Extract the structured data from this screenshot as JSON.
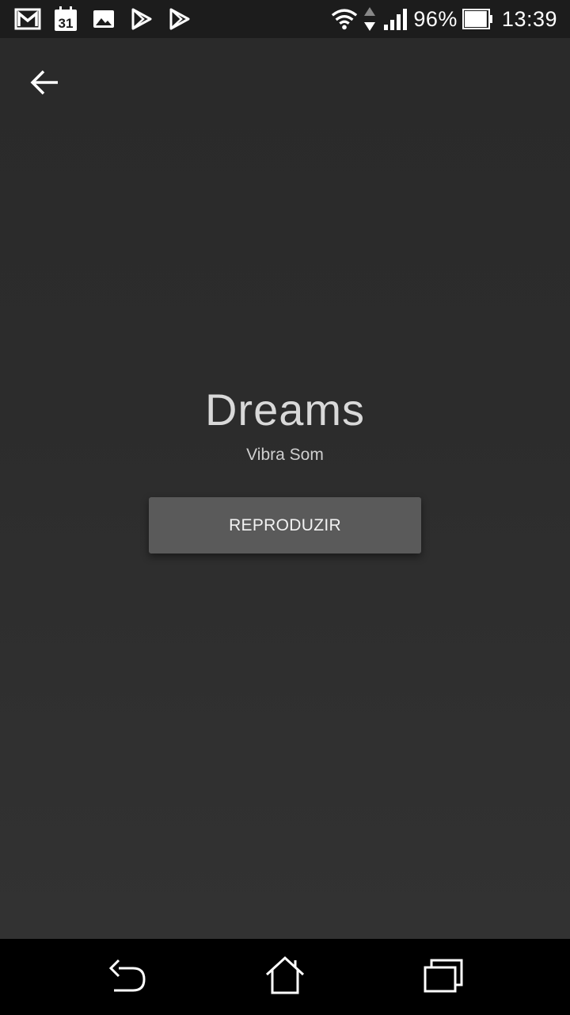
{
  "status_bar": {
    "left_icons": [
      "gmail-icon",
      "calendar-icon",
      "gallery-icon",
      "play-store-icon",
      "play-store-icon"
    ],
    "calendar_day": "31",
    "right_icons": [
      "wifi-icon",
      "data-transfer-icon",
      "signal-icon",
      "battery-icon"
    ],
    "battery_percent": "96%",
    "battery_level": 0.96,
    "time": "13:39"
  },
  "toolbar": {
    "back_icon": "arrow-back-icon"
  },
  "track": {
    "title": "Dreams",
    "artist": "Vibra Som",
    "play_label": "REPRODUZIR"
  },
  "nav_bar": {
    "icons": [
      "back-nav-icon",
      "home-nav-icon",
      "recent-apps-icon"
    ]
  },
  "colors": {
    "background": "#2d2d2d",
    "button": "#5a5a5a",
    "status_bar": "#1c1c1c",
    "nav_bar": "#000000"
  }
}
